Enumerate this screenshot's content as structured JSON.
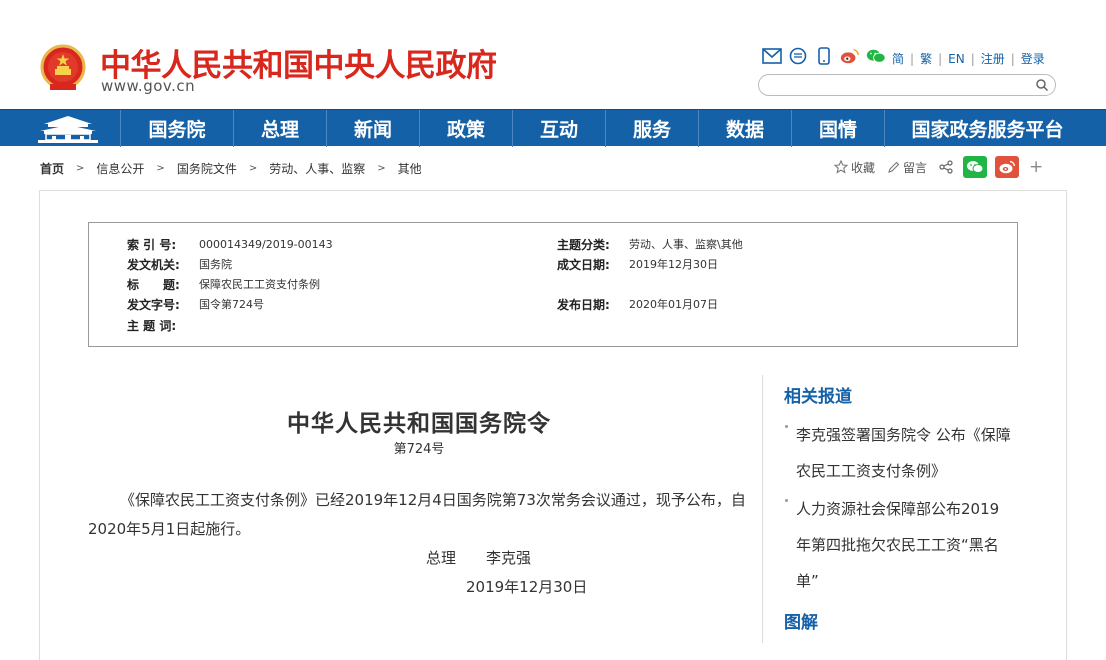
{
  "header": {
    "site_title": "中华人民共和国中央人民政府",
    "site_url": "www.gov.cn",
    "icons": [
      "mail-icon",
      "chat-bubble-icon",
      "mobile-icon",
      "weibo-icon",
      "wechat-icon"
    ],
    "lang_links": [
      "简",
      "繁",
      "EN",
      "注册",
      "登录"
    ],
    "search_placeholder": ""
  },
  "nav": {
    "items": [
      "国务院",
      "总理",
      "新闻",
      "政策",
      "互动",
      "服务",
      "数据",
      "国情",
      "国家政务服务平台"
    ]
  },
  "breadcrumb": {
    "items": [
      "首页",
      "信息公开",
      "国务院文件",
      "劳动、人事、监察",
      "其他"
    ]
  },
  "share": {
    "favorite": "收藏",
    "comment": "留言",
    "plus": "+"
  },
  "meta": {
    "index_label": "索 引 号:",
    "index_value": "000014349/2019-00143",
    "topic_class_label": "主题分类:",
    "topic_class_value": "劳动、人事、监察\\其他",
    "issuer_label": "发文机关:",
    "issuer_value": "国务院",
    "written_date_label": "成文日期:",
    "written_date_value": "2019年12月30日",
    "title_label": "标　　题:",
    "title_value": "保障农民工工资支付条例",
    "doc_no_label": "发文字号:",
    "doc_no_value": "国令第724号",
    "publish_date_label": "发布日期:",
    "publish_date_value": "2020年01月07日",
    "keywords_label": "主 题 词:",
    "keywords_value": ""
  },
  "article": {
    "title": "中华人民共和国国务院令",
    "subtitle": "第724号",
    "paragraph": "《保障农民工工资支付条例》已经2019年12月4日国务院第73次常务会议通过，现予公布，自2020年5月1日起施行。",
    "sign": "总理　　李克强",
    "date": "2019年12月30日"
  },
  "sidebar": {
    "related_title": "相关报道",
    "related_items": [
      "李克强签署国务院令 公布《保障农民工工资支付条例》",
      "人力资源社会保障部公布2019年第四批拖欠农民工工资“黑名单”"
    ],
    "graphic_title": "图解"
  },
  "colors": {
    "brand_red": "#d8271c",
    "nav_blue": "#1561a8",
    "wechat_green": "#21b545",
    "weibo_red": "#e0523b"
  }
}
